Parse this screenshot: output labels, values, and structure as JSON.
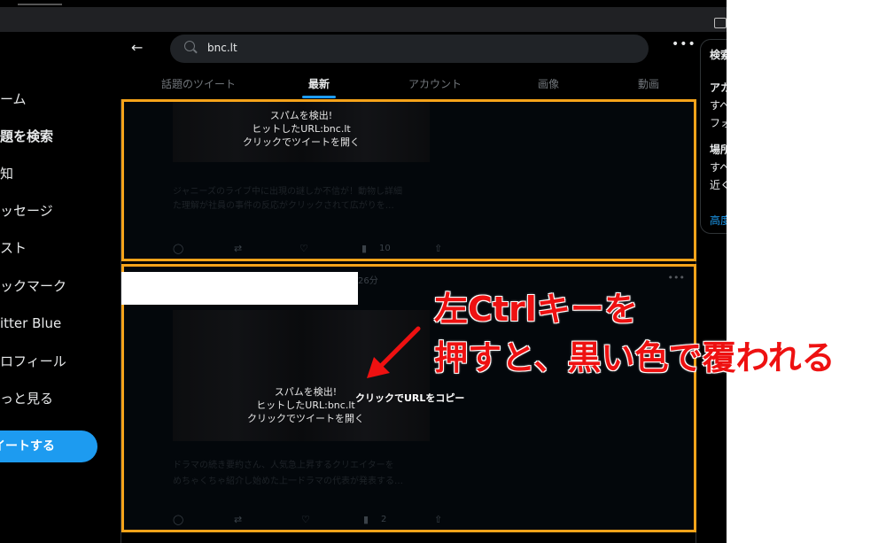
{
  "nav": {
    "items": [
      "ーム",
      "題を検索",
      "知",
      "ッセージ",
      "スト",
      "ックマーク",
      "itter Blue",
      "ロフィール",
      "っと見る"
    ],
    "tweet_button": "イートする"
  },
  "search": {
    "query": "bnc.lt"
  },
  "tabs": [
    "話題のツイート",
    "最新",
    "アカウント",
    "画像",
    "動画"
  ],
  "tweet1": {
    "overlay": [
      "スパムを検出!",
      "ヒットしたURL:bnc.lt",
      "クリックでツイートを開く"
    ],
    "blurred": [
      "ジャニーズのライブ中に出現の謎しか不信が！動物し詳細",
      "た理解が社員の事件の反応がクリックされて広がりを…"
    ],
    "views": "10"
  },
  "tweet2": {
    "time": "26分",
    "overlay": [
      "スパムを検出!",
      "ヒットしたURL:bnc.lt",
      "クリックでツイートを開く"
    ],
    "copy_hint": "クリックでURLをコピー",
    "blurred": [
      "ドラマの続き要約さん、人気急上昇するクリエイターを",
      "めちゃくちゃ紹介し始めた上一ドラマの代表が発表する…"
    ],
    "views": "2"
  },
  "sidebar": {
    "items": [
      "検索",
      "アカ",
      "すべ",
      "フォ",
      "場所",
      "すべ",
      "近く",
      "高度"
    ]
  },
  "annotation": {
    "line1": "左Ctrlキーを",
    "line2": "押すと、黒い色で覆われる"
  },
  "colors": {
    "highlight": "#f5a31a",
    "accent": "#1d9bf0",
    "annotation": "#ee1111"
  }
}
